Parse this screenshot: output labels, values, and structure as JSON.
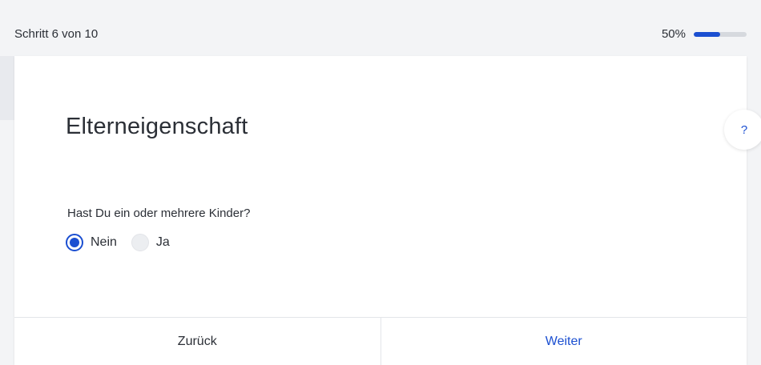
{
  "header": {
    "step_text": "Schritt 6 von 10",
    "progress_text": "50%",
    "progress_value": 0.5
  },
  "card": {
    "title": "Elterneigenschaft",
    "question": "Hast Du ein oder mehrere Kinder?",
    "options": [
      {
        "label": "Nein",
        "selected": true
      },
      {
        "label": "Ja",
        "selected": false
      }
    ],
    "help_label": "?"
  },
  "footer": {
    "back_label": "Zurück",
    "next_label": "Weiter"
  },
  "colors": {
    "accent": "#1b4fd1",
    "background": "#f3f4f6",
    "card": "#ffffff",
    "text": "#2b2f36"
  }
}
